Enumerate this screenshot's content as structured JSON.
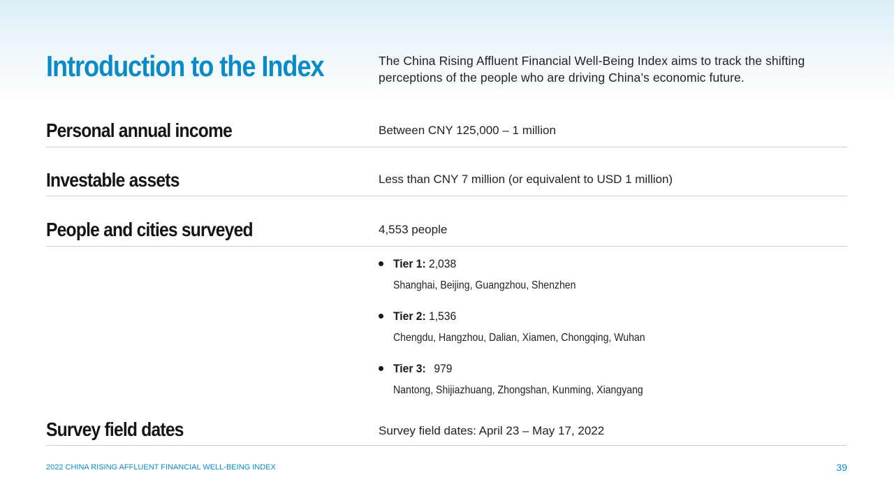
{
  "header": {
    "title": "Introduction to the Index",
    "intro": "The China Rising Affluent Financial Well-Being Index aims to track the shifting perceptions of the people who are driving China’s economic future."
  },
  "rows": [
    {
      "label": "Personal annual income",
      "value": "Between CNY 125,000 – 1 million"
    },
    {
      "label": "Investable assets",
      "value": "Less than CNY 7 million (or equivalent to USD 1 million)"
    },
    {
      "label": "People and cities surveyed",
      "value": "4,553 people"
    },
    {
      "label": "Survey field dates",
      "value": "Survey field dates: April 23 – May 17, 2022"
    }
  ],
  "tiers": [
    {
      "name": "Tier 1:",
      "count": "2,038",
      "cities": "Shanghai, Beijing, Guangzhou, Shenzhen"
    },
    {
      "name": "Tier 2:",
      "count": "1,536",
      "cities": "Chengdu, Hangzhou, Dalian, Xiamen, Chongqing, Wuhan"
    },
    {
      "name": "Tier 3:",
      "count": "979",
      "cities": "Nantong, Shijiazhuang, Zhongshan, Kunming, Xiangyang"
    }
  ],
  "footer": {
    "report_name": "2022 CHINA RISING AFFLUENT FINANCIAL WELL-BEING INDEX",
    "page_number": "39"
  },
  "colors": {
    "accent": "#0a8bc7",
    "text": "#1a1a1a",
    "rule": "#cfcfcf"
  }
}
